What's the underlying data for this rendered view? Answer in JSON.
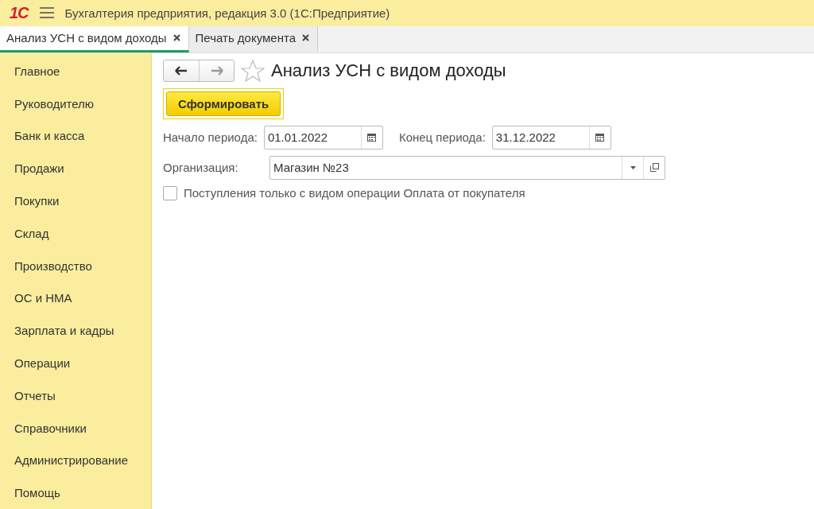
{
  "header": {
    "logo": "1С",
    "title": "Бухгалтерия предприятия, редакция 3.0  (1С:Предприятие)"
  },
  "tabs": [
    {
      "label": "Анализ УСН с видом доходы",
      "selected": true
    },
    {
      "label": "Печать документа",
      "selected": false
    }
  ],
  "sidebar": {
    "items": [
      {
        "label": "Главное"
      },
      {
        "label": "Руководителю"
      },
      {
        "label": "Банк и касса"
      },
      {
        "label": "Продажи"
      },
      {
        "label": "Покупки"
      },
      {
        "label": "Склад"
      },
      {
        "label": "Производство"
      },
      {
        "label": "ОС и НМА"
      },
      {
        "label": "Зарплата и кадры"
      },
      {
        "label": "Операции"
      },
      {
        "label": "Отчеты"
      },
      {
        "label": "Справочники"
      },
      {
        "label": "Администрирование"
      },
      {
        "label": "Помощь"
      }
    ]
  },
  "form": {
    "title": "Анализ УСН с видом доходы",
    "favorite": false,
    "generate_button": "Сформировать",
    "period_start": {
      "label": "Начало периода:",
      "value": "01.01.2022"
    },
    "period_end": {
      "label": "Конец периода:",
      "value": "31.12.2022"
    },
    "organization": {
      "label": "Организация:",
      "value": "Магазин №23"
    },
    "only_payments": {
      "label": "Поступления только с видом операции Оплата от покупателя",
      "checked": false
    }
  }
}
